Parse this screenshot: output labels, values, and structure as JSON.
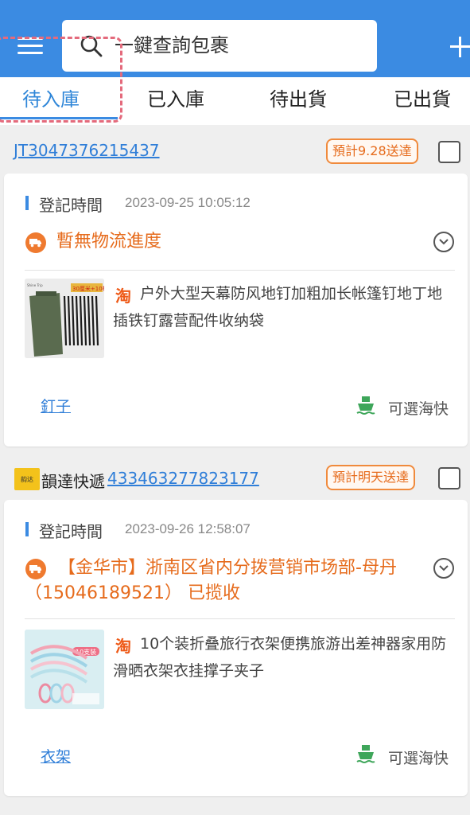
{
  "search": {
    "placeholder": "一鍵查詢包裹",
    "value": ""
  },
  "tabs": [
    {
      "label": "待入庫",
      "active": true
    },
    {
      "label": "已入庫",
      "active": false
    },
    {
      "label": "待出貨",
      "active": false
    },
    {
      "label": "已出貨",
      "active": false
    }
  ],
  "packages": [
    {
      "carrier_name": "",
      "tracking_number": "JT3047376215437",
      "eta": "預計9.28送達",
      "register_label": "登記時間",
      "register_time": "2023-09-25 10:05:12",
      "logistics_status": "暫無物流進度",
      "product_title": "户外大型天幕防风地钉加粗加长帐篷钉地丁地插铁钉露营配件收纳袋",
      "thumb_caption": "30厘米+10根",
      "note": "釘子",
      "shipping_option": "可選海快"
    },
    {
      "carrier_name": "韻達快遞",
      "carrier_logo_text": "韵达",
      "tracking_number": "433463277823177",
      "eta": "預計明天送達",
      "register_label": "登記時間",
      "register_time": "2023-09-26 12:58:07",
      "logistics_status": "【金华市】浙南区省内分拨营销市场部-母丹（15046189521） 已揽收",
      "product_title": "10个装折叠旅行衣架便携旅游出差神器家用防滑晒衣架衣挂撑子夹子",
      "thumb_caption": "10支装",
      "note": "衣架",
      "shipping_option": "可選海快"
    }
  ],
  "colors": {
    "header": "#3b8be2",
    "accent_orange": "#e66b1c",
    "link_blue": "#2f7ed8",
    "ship_green": "#3ea65a"
  },
  "icons": {
    "menu": "menu-icon",
    "search": "search-icon",
    "add": "plus-icon",
    "truck": "truck-icon",
    "expand": "chevron-down-icon",
    "taobao": "taobao-icon",
    "ship": "ship-icon"
  },
  "taobao_glyph": "淘"
}
